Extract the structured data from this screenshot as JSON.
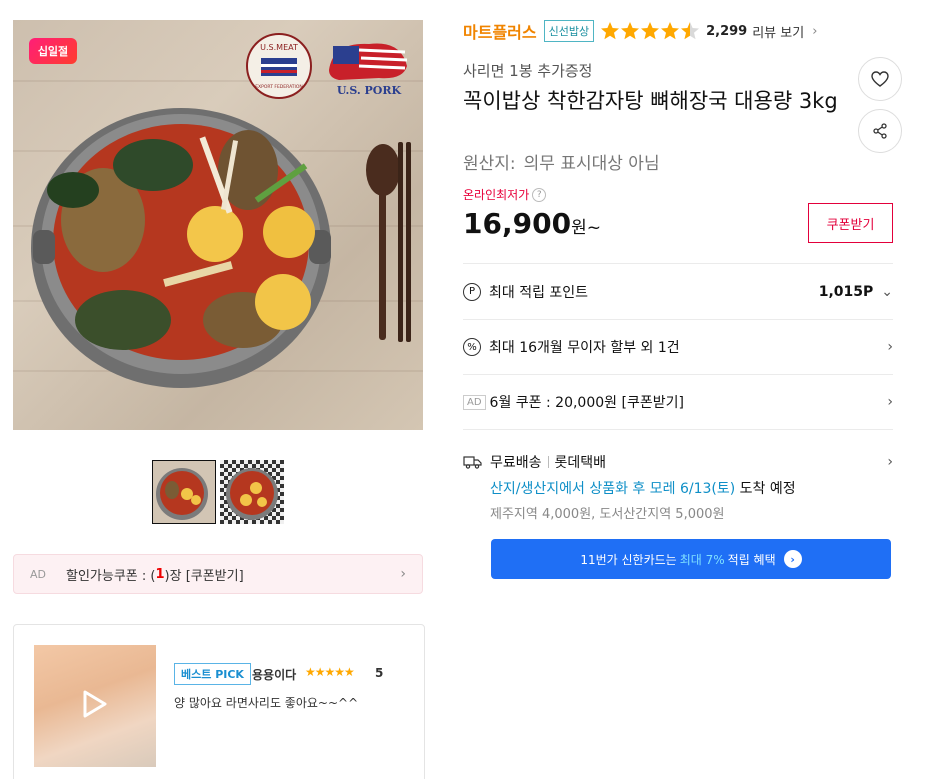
{
  "gallery": {
    "badge": "십일절",
    "logo_meat_text": "U.S.MEAT",
    "logo_meat_sub": "EXPORT FEDERATION",
    "logo_pork_text": "U.S. PORK",
    "thumbnails": [
      "thumb-1",
      "thumb-2"
    ]
  },
  "coupon_bar": {
    "ad": "AD",
    "label": "할인가능쿠폰 : (",
    "count": "1",
    "suffix": ")장 [쿠폰받기]"
  },
  "review": {
    "badge": "베스트 PICK",
    "author": "용용이다",
    "stars": "★★★★★",
    "score": "5",
    "text": "양 많아요 라면사리도 좋아요~~^^"
  },
  "product": {
    "seller": "마트플러스",
    "seller_badge": "신선밥상",
    "rating": 4.5,
    "review_count": "2,299",
    "review_link": "리뷰 보기",
    "subtitle": "사리면 1봉 추가증정",
    "title": "꼭이밥상 착한감자탕 뼈해장국 대용량 3kg",
    "origin_label": "원산지:",
    "origin_value": "의무 표시대상 아님",
    "low_price_label": "온라인최저가",
    "price": "16,900",
    "price_unit": "원~",
    "coupon_button": "쿠폰받기"
  },
  "info_rows": {
    "point_label": "최대 적립 포인트",
    "point_value": "1,015P",
    "install_label": "최대 16개월 무이자 할부 외 1건",
    "ad_badge": "AD",
    "ad_label": "6월 쿠폰 : 20,000원 [쿠폰받기]"
  },
  "shipping": {
    "free": "무료배송",
    "carrier": "롯데택배",
    "arrival_highlight": "산지/생산지에서 상품화 후 모레 6/13(토)",
    "arrival_suffix": " 도착 예정",
    "extra": "제주지역 4,000원, 도서산간지역 5,000원"
  },
  "card_banner": {
    "prefix": "11번가 신한카드는",
    "highlight": "최대 7%",
    "suffix": "적립 혜택"
  },
  "colors": {
    "seller": "#f08400",
    "price_red": "#e3003b",
    "banner_blue": "#1f6ff5",
    "star": "#ffa800"
  }
}
